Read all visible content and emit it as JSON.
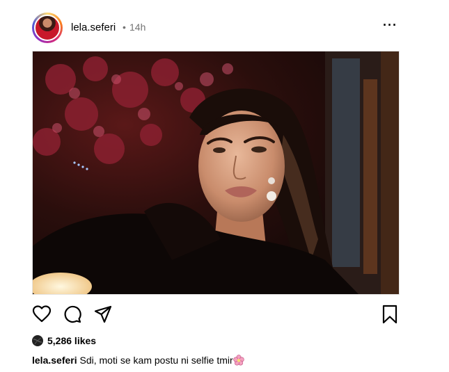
{
  "post": {
    "username": "lela.seferi",
    "separator": "•",
    "time": "14h",
    "likes": "5,286 likes",
    "caption_user": "lela.seferi",
    "caption_text": "Sdi, moti se kam postu ni selfie tmir",
    "caption_emoji": "flower-icon"
  },
  "icons": {
    "more": "more-options-icon",
    "like": "heart-icon",
    "comment": "comment-icon",
    "share": "share-icon",
    "save": "bookmark-icon"
  },
  "colors": {
    "text": "#000000",
    "muted": "#737373",
    "ring_start": "#feda75",
    "ring_end": "#962fbf"
  }
}
